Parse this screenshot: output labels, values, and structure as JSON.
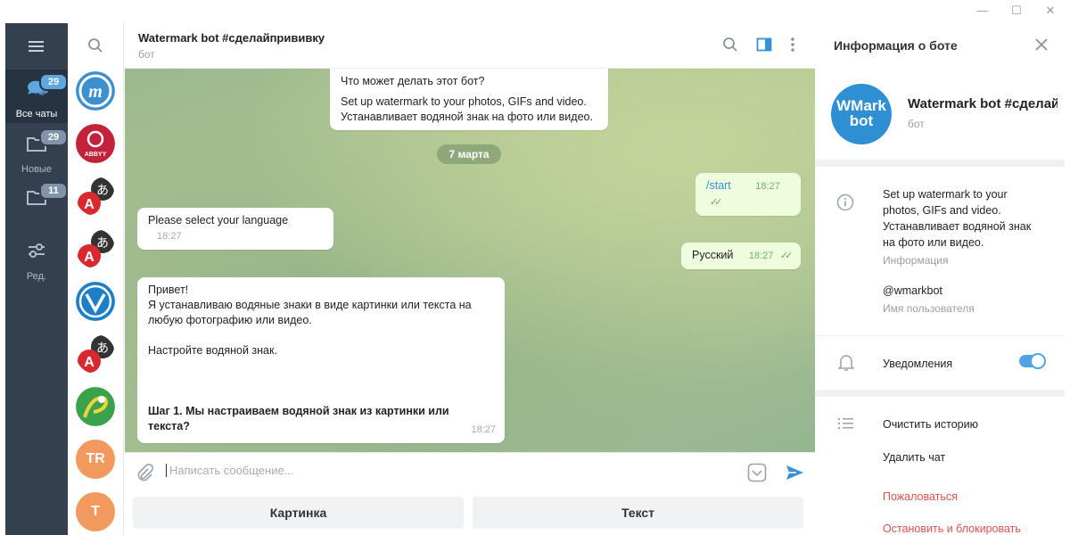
{
  "window": {
    "minimize": "—",
    "maximize": "☐",
    "close": "✕"
  },
  "rail": {
    "items": [
      {
        "label": "Все чаты",
        "badge": "29",
        "icon": "chats-icon",
        "active": true
      },
      {
        "label": "Новые",
        "badge": "29",
        "icon": "folder-icon"
      },
      {
        "label": "",
        "badge": "11",
        "icon": "folder-icon"
      },
      {
        "label": "Ред.",
        "badge": "",
        "icon": "edit-filters-icon"
      }
    ]
  },
  "chatlist": {
    "avatars": [
      {
        "name": "avatar-chat-1"
      },
      {
        "name": "avatar-abbyy",
        "text": "ABBYY"
      },
      {
        "name": "avatar-translator-1"
      },
      {
        "name": "avatar-translator-2"
      },
      {
        "name": "avatar-chat-5"
      },
      {
        "name": "avatar-translator-3"
      },
      {
        "name": "avatar-chat-7"
      },
      {
        "name": "avatar-tr",
        "text": "TR"
      },
      {
        "name": "avatar-t",
        "text": "T"
      }
    ]
  },
  "header": {
    "title": "Watermark bot #сделайпрививку",
    "subtitle": "бот"
  },
  "messages": {
    "intro_title": "Что может делать этот бот?",
    "intro_line1": "Set up watermark to your photos, GIFs and video.",
    "intro_line2": "Устанавливает водяной знак на фото или видео.",
    "date": "7 марта",
    "start_cmd": "/start",
    "start_time": "18:27",
    "select_lang": "Please select your language",
    "select_lang_time": "18:27",
    "russian": "Русский",
    "russian_time": "18:27",
    "greet_1": "Привет!",
    "greet_2": "Я устанавливаю водяные знаки в виде картинки или текста на",
    "greet_3": "любую фотографию или видео.",
    "greet_4": "Настройте водяной знак.",
    "greet_5": "Шаг 1. Мы настраиваем водяной знак из картинки или",
    "greet_6": "текста?",
    "greet_time": "18:27"
  },
  "composer": {
    "placeholder": "Написать сообщение..."
  },
  "keyboard": {
    "btn1": "Картинка",
    "btn2": "Текст"
  },
  "info": {
    "title": "Информация о боте",
    "avatar_line1": "WMark",
    "avatar_line2": "bot",
    "bot_name": "Watermark bot #сделайпрививку",
    "bot_sub": "бот",
    "about_1": "Set up watermark to your",
    "about_2": "photos, GIFs and video.",
    "about_3": "Устанавливает водяной знак",
    "about_4": "на фото или видео.",
    "about_label": "Информация",
    "username": "@wmarkbot",
    "username_label": "Имя пользователя",
    "notifications": "Уведомления",
    "clear_history": "Очистить историю",
    "delete_chat": "Удалить чат",
    "report": "Пожаловаться",
    "block": "Остановить и блокировать"
  },
  "colors": {
    "accent": "#4ea4e3",
    "rail": "#34404f",
    "outgoing": "#effdde",
    "danger": "#e0504e"
  }
}
